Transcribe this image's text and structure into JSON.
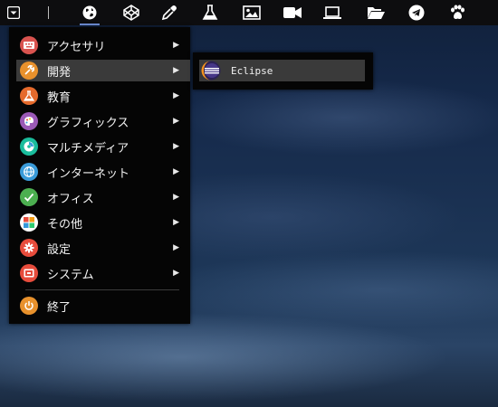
{
  "taskbar": {
    "launchers": [
      {
        "icon": "menu-dropdown-icon"
      },
      {
        "icon": "globe-icon"
      },
      {
        "icon": "codepen-icon"
      },
      {
        "icon": "eyedropper-icon"
      },
      {
        "icon": "flask-icon"
      },
      {
        "icon": "image-icon"
      },
      {
        "icon": "video-camera-icon"
      },
      {
        "icon": "laptop-icon"
      },
      {
        "icon": "folder-open-icon"
      },
      {
        "icon": "telegram-icon"
      },
      {
        "icon": "paw-icon"
      }
    ],
    "active": "globe-icon",
    "accent_color": "#6f8fd8"
  },
  "menu": {
    "items": [
      {
        "label": "アクセサリ",
        "icon": "accessories-icon",
        "color": "#d9534f",
        "has_submenu": true
      },
      {
        "label": "開発",
        "icon": "development-icon",
        "color": "#e8912c",
        "has_submenu": true,
        "highlighted": true
      },
      {
        "label": "教育",
        "icon": "education-icon",
        "color": "#e56a2c",
        "has_submenu": true
      },
      {
        "label": "グラフィックス",
        "icon": "graphics-icon",
        "color": "#9b59b6",
        "has_submenu": true
      },
      {
        "label": "マルチメディア",
        "icon": "multimedia-icon",
        "color": "#1abc9c",
        "has_submenu": true
      },
      {
        "label": "インターネット",
        "icon": "internet-icon",
        "color": "#3a9bd9",
        "has_submenu": true
      },
      {
        "label": "オフィス",
        "icon": "office-icon",
        "color": "#4caf50",
        "has_submenu": true
      },
      {
        "label": "その他",
        "icon": "other-icon",
        "color": "#e74c3c",
        "has_submenu": true
      },
      {
        "label": "設定",
        "icon": "settings-icon",
        "color": "#e74c3c",
        "has_submenu": true
      },
      {
        "label": "システム",
        "icon": "system-icon",
        "color": "#e74c3c",
        "has_submenu": true
      }
    ],
    "quit": {
      "label": "終了",
      "icon": "power-icon",
      "color": "#e8912c"
    },
    "arrow_glyph": "▶"
  },
  "submenu": {
    "items": [
      {
        "label": "Eclipse",
        "icon": "eclipse-icon"
      }
    ]
  }
}
